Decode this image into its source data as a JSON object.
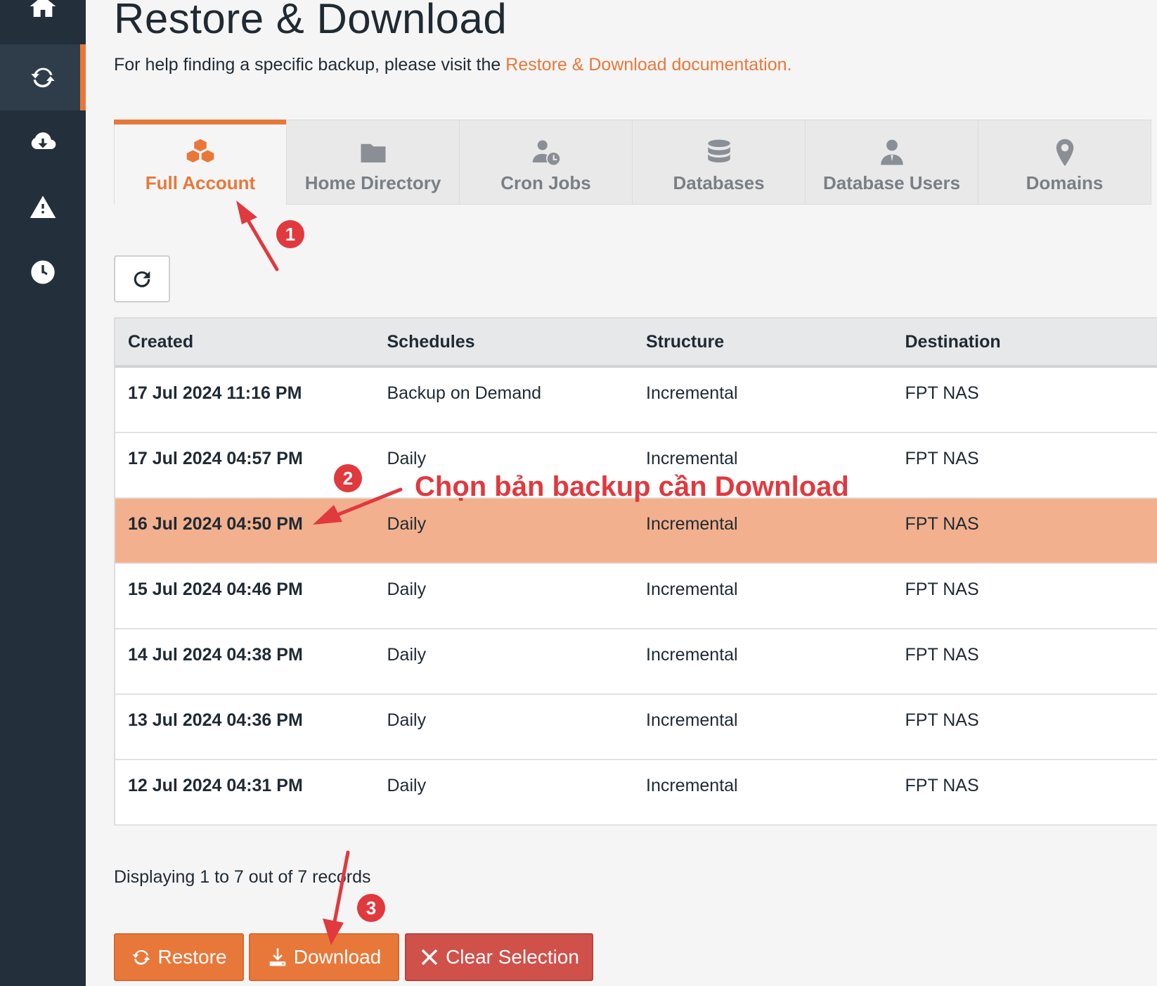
{
  "sidebar": {
    "items": [
      {
        "icon": "home-icon"
      },
      {
        "icon": "sync-icon",
        "active": true
      },
      {
        "icon": "cloud-download-icon"
      },
      {
        "icon": "warning-icon"
      },
      {
        "icon": "clock-icon"
      }
    ]
  },
  "page": {
    "title": "Restore & Download",
    "help_prefix": "For help finding a specific backup, please visit the ",
    "help_link": "Restore & Download documentation."
  },
  "tabs": [
    {
      "label": "Full Account",
      "icon": "cubes-icon",
      "active": true
    },
    {
      "label": "Home Directory",
      "icon": "folder-icon"
    },
    {
      "label": "Cron Jobs",
      "icon": "user-clock-icon"
    },
    {
      "label": "Databases",
      "icon": "database-icon"
    },
    {
      "label": "Database Users",
      "icon": "user-tie-icon"
    },
    {
      "label": "Domains",
      "icon": "map-marker-icon"
    }
  ],
  "annotations": {
    "badge1": "1",
    "badge2": "2",
    "badge3": "3",
    "note": "Chọn bản backup cần Download"
  },
  "table": {
    "headers": [
      "Created",
      "Schedules",
      "Structure",
      "Destination"
    ],
    "rows": [
      {
        "created": "17 Jul 2024 11:16 PM",
        "schedule": "Backup on Demand",
        "structure": "Incremental",
        "destination": "FPT NAS"
      },
      {
        "created": "17 Jul 2024 04:57 PM",
        "schedule": "Daily",
        "structure": "Incremental",
        "destination": "FPT NAS"
      },
      {
        "created": "16 Jul 2024 04:50 PM",
        "schedule": "Daily",
        "structure": "Incremental",
        "destination": "FPT NAS",
        "selected": true
      },
      {
        "created": "15 Jul 2024 04:46 PM",
        "schedule": "Daily",
        "structure": "Incremental",
        "destination": "FPT NAS"
      },
      {
        "created": "14 Jul 2024 04:38 PM",
        "schedule": "Daily",
        "structure": "Incremental",
        "destination": "FPT NAS"
      },
      {
        "created": "13 Jul 2024 04:36 PM",
        "schedule": "Daily",
        "structure": "Incremental",
        "destination": "FPT NAS"
      },
      {
        "created": "12 Jul 2024 04:31 PM",
        "schedule": "Daily",
        "structure": "Incremental",
        "destination": "FPT NAS"
      }
    ]
  },
  "records": "Displaying 1 to 7 out of 7 records",
  "buttons": {
    "restore": "Restore",
    "download": "Download",
    "clear": "Clear Selection"
  },
  "colors": {
    "accent": "#e8783a",
    "sidebar": "#232f3b",
    "selected_row": "#f3b08e",
    "danger": "#d0504a",
    "annotation": "#e0393e"
  }
}
